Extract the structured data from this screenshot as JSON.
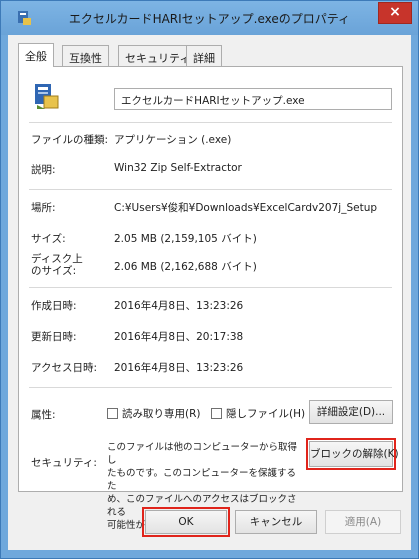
{
  "window": {
    "title": "エクセルカードHARIセットアップ.exeのプロパティ",
    "close_label": "×"
  },
  "tabs": [
    {
      "label": "全般",
      "active": true
    },
    {
      "label": "互換性",
      "active": false
    },
    {
      "label": "セキュリティ",
      "active": false
    },
    {
      "label": "詳細",
      "active": false
    }
  ],
  "general": {
    "file_name": "エクセルカードHARIセットアップ.exe",
    "type_label": "ファイルの種類:",
    "type_value": "アプリケーション (.exe)",
    "description_label": "説明:",
    "description_value": "Win32 Zip Self-Extractor",
    "location_label": "場所:",
    "location_value": "C:¥Users¥俊和¥Downloads¥ExcelCardv207j_Setup",
    "size_label": "サイズ:",
    "size_value": "2.05 MB (2,159,105 バイト)",
    "disk_size_label_1": "ディスク上",
    "disk_size_label_2": "のサイズ:",
    "disk_size_value": "2.06 MB (2,162,688 バイト)",
    "created_label": "作成日時:",
    "created_value": "2016年4月8日、13:23:26",
    "modified_label": "更新日時:",
    "modified_value": "2016年4月8日、20:17:38",
    "accessed_label": "アクセス日時:",
    "accessed_value": "2016年4月8日、13:23:26",
    "attributes_label": "属性:",
    "readonly_label": "読み取り専用(R)",
    "readonly_checked": false,
    "hidden_label": "隠しファイル(H)",
    "hidden_checked": false,
    "advanced_button": "詳細設定(D)...",
    "security_label": "セキュリティ:",
    "security_text_1": "このファイルは他のコンピューターから取得し",
    "security_text_2": "たものです。このコンピューターを保護するた",
    "security_text_3": "め、このファイルへのアクセスはブロックされる",
    "security_text_4": "可能性があります。",
    "unblock_button": "ブロックの解除(K)"
  },
  "footer": {
    "ok": "OK",
    "cancel": "キャンセル",
    "apply": "適用(A)"
  },
  "colors": {
    "titlebar": "#6fa8dc",
    "close": "#c7342b",
    "highlight": "#e0241b"
  }
}
